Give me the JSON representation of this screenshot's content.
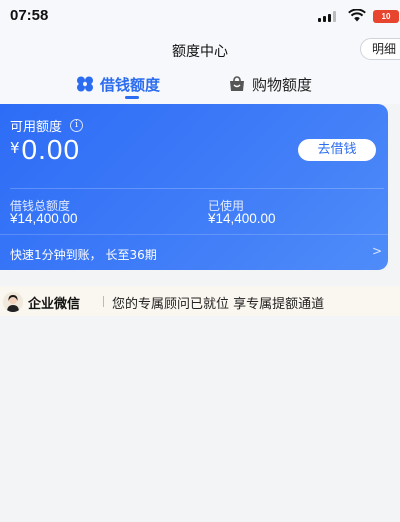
{
  "status_bar": {
    "time": "07:58",
    "battery": "10"
  },
  "header": {
    "title": "额度中心",
    "detail_button": "明细"
  },
  "tabs": [
    {
      "label": "借钱额度",
      "icon": "clover-icon",
      "active": true
    },
    {
      "label": "购物额度",
      "icon": "shopping-bag-icon",
      "active": false
    }
  ],
  "card": {
    "available_label": "可用额度",
    "currency": "¥",
    "available_amount": "0.00",
    "borrow_button": "去借钱",
    "total_label": "借钱总额度",
    "total_value": "¥14,400.00",
    "used_label": "已使用",
    "used_value": "¥14,400.00",
    "promo": "快速1分钟到账， 长至36期",
    "promo_chevron": ">"
  },
  "wecom": {
    "title": "企业微信",
    "message": "您的专属顾问已就位 享专属提额通道"
  },
  "colors": {
    "accent": "#2b6cf0",
    "card": "#3f7cf8",
    "battery": "#e8452e"
  }
}
